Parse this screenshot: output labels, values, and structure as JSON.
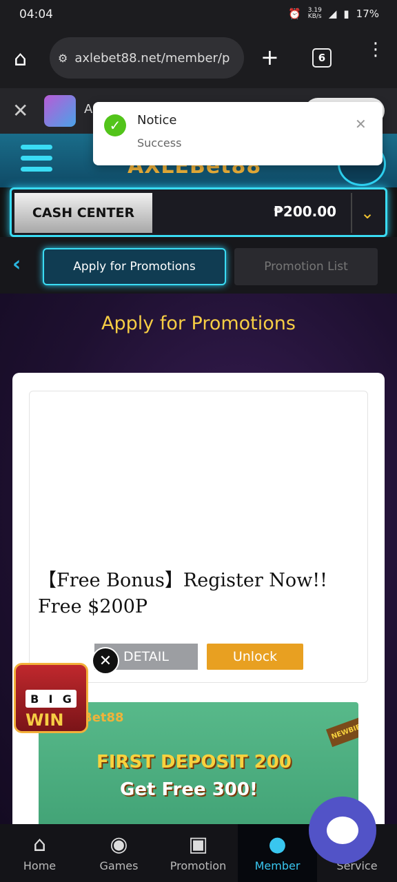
{
  "status": {
    "time": "04:04",
    "speed": "3.19\nKB/s",
    "battery": "17%"
  },
  "browser": {
    "url": "axlebet88.net/member/p",
    "tab_count": "6"
  },
  "appbar": {
    "title": "A"
  },
  "toast": {
    "title": "Notice",
    "message": "Success"
  },
  "header": {
    "logo": "AXLEBet88"
  },
  "cash": {
    "label": "CASH CENTER",
    "amount": "₱200.00"
  },
  "tabs": [
    {
      "label": "Apply for Promotions",
      "active": true
    },
    {
      "label": "Promotion List",
      "active": false
    }
  ],
  "page": {
    "title": "Apply for Promotions"
  },
  "promo": {
    "title": "【Free Bonus】Register Now!! Free $200P",
    "detail": "DETAIL",
    "unlock": "Unlock"
  },
  "banner": {
    "brand": "Bet88",
    "line1": "FIRST DEPOSIT 200",
    "line2": "Get Free 300!",
    "badge": "NEWBIE"
  },
  "bigwin": {
    "reel": [
      "B",
      "I",
      "G"
    ],
    "win": "WIN"
  },
  "nav": [
    {
      "label": "Home",
      "icon": "home-icon"
    },
    {
      "label": "Games",
      "icon": "gamepad-icon"
    },
    {
      "label": "Promotion",
      "icon": "gift-icon"
    },
    {
      "label": "Member",
      "icon": "member-icon"
    },
    {
      "label": "Service",
      "icon": "service-icon"
    }
  ],
  "colors": {
    "accent": "#3adcf4",
    "gold": "#f6cd44",
    "unlock": "#e8a021",
    "active_nav": "#39c6ef"
  }
}
